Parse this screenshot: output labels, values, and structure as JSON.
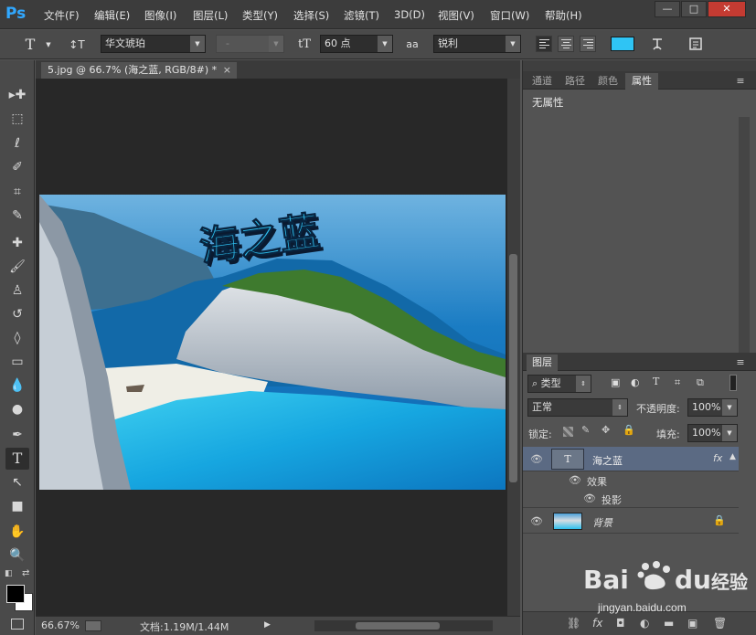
{
  "app": {
    "logo": "Ps"
  },
  "menu": [
    "文件(F)",
    "编辑(E)",
    "图像(I)",
    "图层(L)",
    "类型(Y)",
    "选择(S)",
    "滤镜(T)",
    "3D(D)",
    "视图(V)",
    "窗口(W)",
    "帮助(H)"
  ],
  "window_controls": {
    "minimize": "—",
    "maximize": "□",
    "close": "✕"
  },
  "options_bar": {
    "tool_icon": "T",
    "orientation_icon": "↕T",
    "font_family": "华文琥珀",
    "font_style": "-",
    "font_size_icon": "tT",
    "font_size": "60 点",
    "antialias_icon": "aa",
    "antialias": "锐利",
    "text_color": "#2fc4f4",
    "warp_icon": "warp-text-icon",
    "panels_icon": "character-panel-icon"
  },
  "document": {
    "tab_title": "5.jpg @ 66.7% (海之蓝, RGB/8#) *",
    "tab_close": "×",
    "canvas_text": "海之蓝",
    "text_color": "#2fc4f4"
  },
  "status": {
    "zoom": "66.67%",
    "doc_info": "文档:1.19M/1.44M",
    "arrow": "▶"
  },
  "properties_panel": {
    "tabs": [
      "通道",
      "路径",
      "颜色",
      "属性"
    ],
    "active_tab": "属性",
    "content": "无属性"
  },
  "layers_panel": {
    "title": "图层",
    "filter_kind": "类型",
    "blend_mode": "正常",
    "opacity_label": "不透明度:",
    "opacity": "100%",
    "lock_label": "锁定:",
    "fill_label": "填充:",
    "fill": "100%",
    "layers": [
      {
        "name": "海之蓝",
        "type": "text",
        "selected": true,
        "fx": "fx",
        "thumb": "T"
      },
      {
        "name": "效果",
        "type": "effect-group"
      },
      {
        "name": "投影",
        "type": "effect"
      },
      {
        "name": "背景",
        "type": "image",
        "locked": true
      }
    ]
  },
  "watermark": {
    "brand": "Bai du 经验",
    "url": "jingyan.baidu.com"
  }
}
